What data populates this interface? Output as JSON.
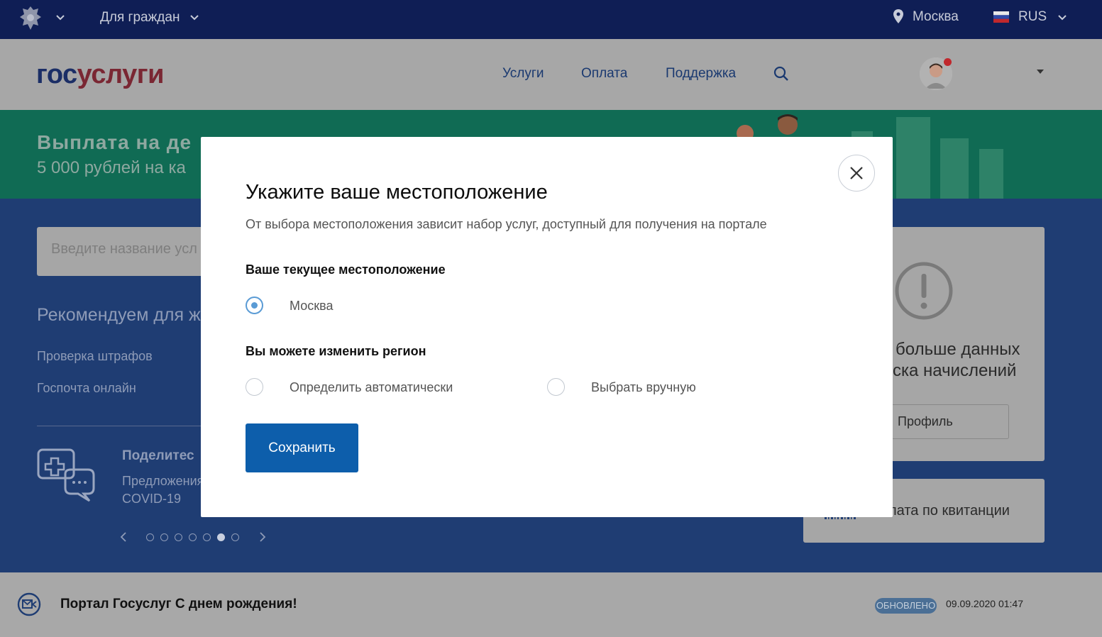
{
  "topbar": {
    "audience": "Для граждан",
    "city": "Москва",
    "language": "RUS",
    "emblem_icon": "coat-of-arms-icon",
    "location_icon": "location-pin-icon",
    "flag_icon": "russia-flag-icon"
  },
  "header": {
    "logo_part1": "гос",
    "logo_part2": "услуги",
    "nav": [
      "Услуги",
      "Оплата",
      "Поддержка"
    ],
    "search_icon": "search-icon",
    "avatar_icon": "avatar-icon"
  },
  "banner": {
    "title": "Выплата на де",
    "subtitle": "5 000 рублей на ка"
  },
  "main": {
    "search_placeholder": "Введите название усл",
    "recommend_title": "Рекомендуем для ж",
    "links": [
      "Проверка штрафов",
      "Госпочта онлайн"
    ],
    "share_title": "Поделитес",
    "share_text_line1": "Предложения",
    "share_text_line2": "COVID-19",
    "carousel_total": 7,
    "carousel_active": 6,
    "card": {
      "text_line1": "больше данных",
      "text_line2": "ска начислений",
      "button": "Профиль"
    },
    "pay_card": {
      "text": "лата по квитанции"
    }
  },
  "news": {
    "title": "Портал Госуслуг С днем рождения!",
    "badge": "ОБНОВЛЕНО",
    "date": "09.09.2020 01:47"
  },
  "modal": {
    "title": "Укажите ваше местоположение",
    "description": "От выбора местоположения зависит набор услуг, доступный для получения на портале",
    "current_heading": "Ваше текущее местоположение",
    "current_value": "Москва",
    "change_heading": "Вы можете изменить регион",
    "option_auto": "Определить автоматически",
    "option_manual": "Выбрать вручную",
    "save_label": "Сохранить"
  },
  "colors": {
    "topbar": "#0f1e55",
    "accent_blue": "#0d5eab",
    "radio_checked": "#5a9bd5",
    "logo_red": "#7a2733"
  }
}
